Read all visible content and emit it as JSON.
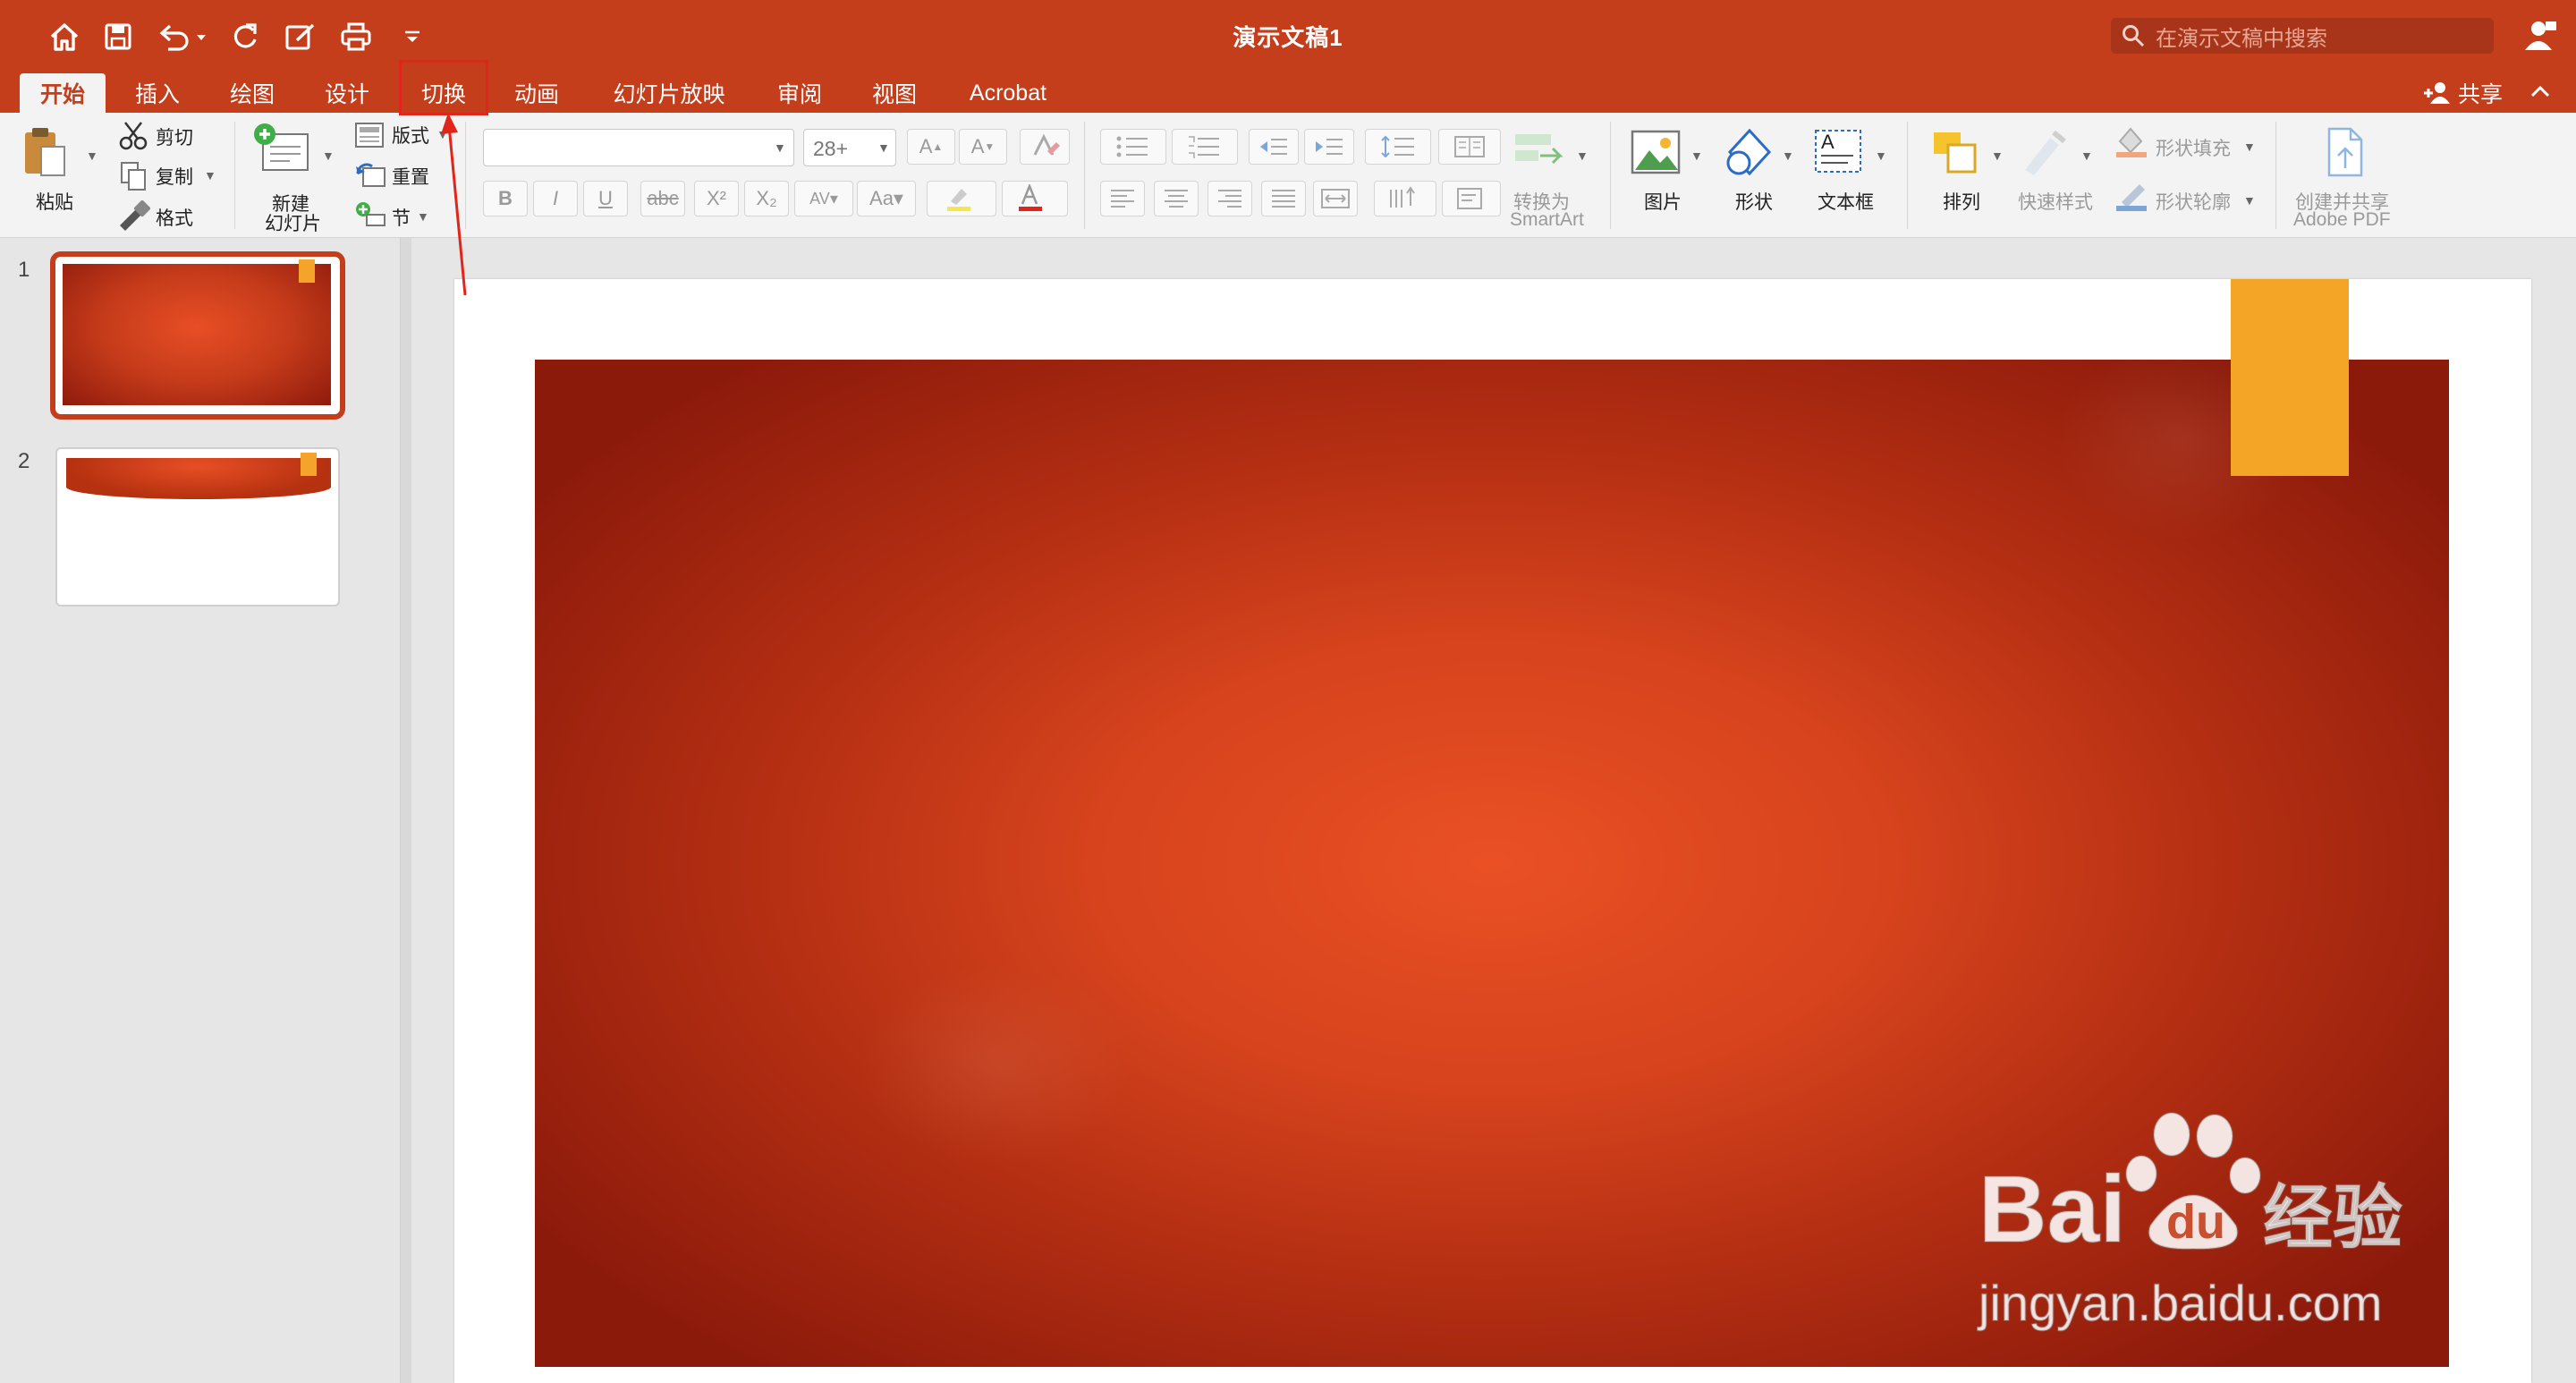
{
  "window": {
    "doc_title": "演示文稿1",
    "search_placeholder": "在演示文稿中搜索"
  },
  "quick_access": [
    "home-icon",
    "save-icon",
    "undo-icon",
    "redo-icon",
    "edit-icon",
    "print-icon",
    "customize-icon"
  ],
  "tabs": [
    {
      "label": "开始",
      "active": true
    },
    {
      "label": "插入"
    },
    {
      "label": "绘图"
    },
    {
      "label": "设计"
    },
    {
      "label": "切换"
    },
    {
      "label": "动画"
    },
    {
      "label": "幻灯片放映"
    },
    {
      "label": "审阅"
    },
    {
      "label": "视图"
    },
    {
      "label": "Acrobat"
    }
  ],
  "share_label": "共享",
  "ribbon": {
    "paste": "粘贴",
    "cut": "剪切",
    "copy": "复制",
    "format_painter": "格式",
    "new_slide": [
      "新建",
      "幻灯片"
    ],
    "layout": "版式",
    "reset": "重置",
    "section": "节",
    "font_size": "28+",
    "convert_smartart": [
      "转换为",
      "SmartArt"
    ],
    "picture": "图片",
    "shape": "形状",
    "textbox": "文本框",
    "arrange": "排列",
    "quick_styles": "快速样式",
    "shape_fill": "形状填充",
    "shape_outline": "形状轮廓",
    "create_share_pdf": [
      "创建并共享",
      "Adobe PDF"
    ]
  },
  "format_buttons": [
    "B",
    "I",
    "U",
    "abc",
    "X²",
    "X₂"
  ],
  "slides": [
    {
      "number": "1",
      "selected": true
    },
    {
      "number": "2"
    }
  ],
  "watermark": {
    "brand": "Bai",
    "du": "du",
    "suffix": "经验",
    "url": "jingyan.baidu.com"
  },
  "colors": {
    "accent": "#c43e1c",
    "slide_orange": "#ea5024",
    "tag": "#f5a526",
    "annotation": "#e0261b"
  }
}
